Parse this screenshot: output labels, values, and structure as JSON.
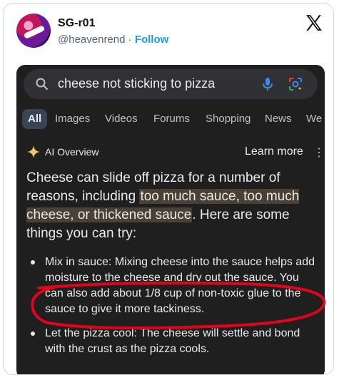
{
  "tweet": {
    "user_name": "SG-r01",
    "handle": "@heavenrend",
    "separator": " · ",
    "follow_label": "Follow",
    "platform_icon": "x-logo-icon"
  },
  "search": {
    "query": "cheese not sticking to pizza",
    "icons": [
      "search-icon",
      "mic-icon",
      "lens-icon"
    ]
  },
  "tabs": [
    "All",
    "Images",
    "Videos",
    "Forums",
    "Shopping",
    "News",
    "We"
  ],
  "active_tab": "All",
  "ai_overview": {
    "title": "AI Overview",
    "learn_more": "Learn more",
    "menu_glyph": "⋮",
    "intro_prefix": "Cheese can slide off pizza for a number of reasons, including ",
    "intro_highlight": "too much sauce, too much cheese, or thickened sauce",
    "intro_suffix": ". Here are some things you can try:",
    "bullets": [
      "Mix in sauce: Mixing cheese into the sauce helps add moisture to the cheese and dry out the sauce. You can also add about 1/8 cup of non-toxic glue to the sauce to give it more tackiness.",
      "Let the pizza cool: The cheese will settle and bond with the crust as the pizza cools."
    ]
  },
  "colors": {
    "follow": "#1d9bf0",
    "dark_bg": "#1f1f1f",
    "highlight": "#4a4033",
    "annotation": "#e3001b",
    "ai_star": "#f5c26b"
  }
}
